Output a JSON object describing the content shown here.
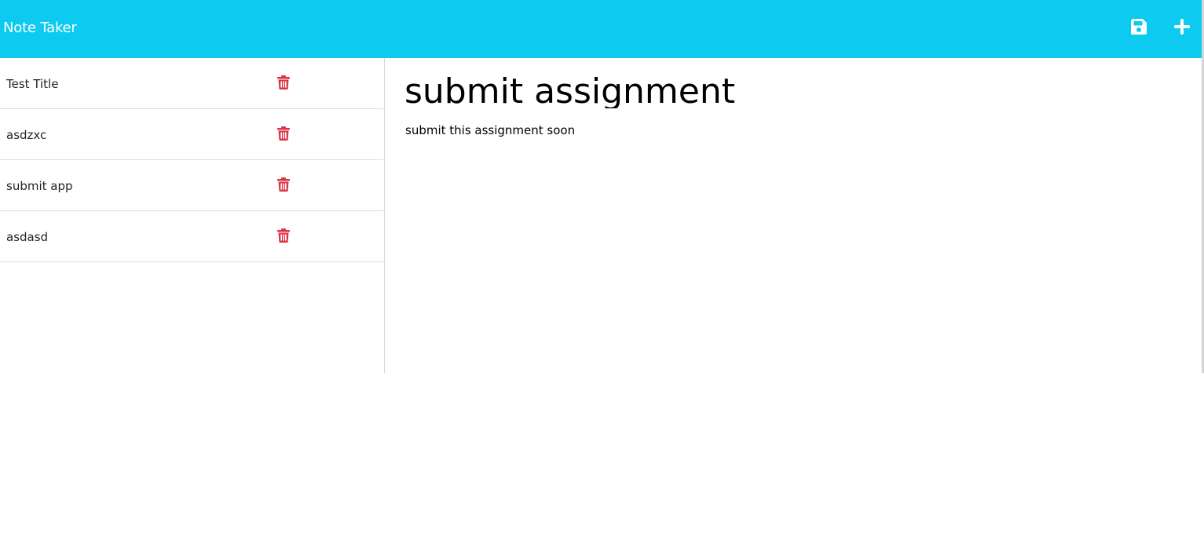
{
  "navbar": {
    "brand": "Note Taker",
    "background_color": "#0dcaf0",
    "icons": {
      "save": "floppy-disk-icon",
      "new_note": "plus-icon"
    }
  },
  "sidebar": {
    "notes": [
      {
        "title": "Test Title"
      },
      {
        "title": "asdzxc"
      },
      {
        "title": "submit app"
      },
      {
        "title": "asdasd"
      }
    ],
    "delete_icon": "trash-icon",
    "delete_color": "#dc3545"
  },
  "editor": {
    "title": "submit assignment",
    "body": "submit this assignment soon"
  }
}
